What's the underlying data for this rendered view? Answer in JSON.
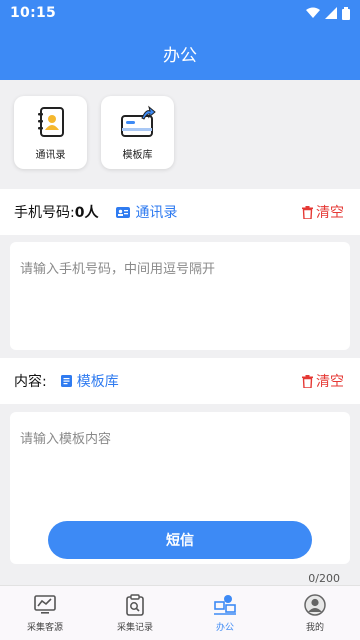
{
  "status_bar": {
    "time": "10:15"
  },
  "header": {
    "title": "办公"
  },
  "shortcuts": [
    {
      "label": "通讯录",
      "icon": "contacts-book-icon"
    },
    {
      "label": "模板库",
      "icon": "template-library-icon"
    }
  ],
  "phone_row": {
    "label": "手机号码:",
    "count": "0人",
    "contacts_link": "通讯录",
    "clear_label": "清空"
  },
  "phone_input": {
    "placeholder": "请输入手机号码，中间用逗号隔开",
    "value": ""
  },
  "content_row": {
    "label": "内容:",
    "template_link": "模板库",
    "clear_label": "清空"
  },
  "content_input": {
    "placeholder": "请输入模板内容",
    "value": ""
  },
  "send_button": {
    "label": "短信"
  },
  "char_counter": "0/200",
  "tabbar": {
    "tabs": [
      {
        "label": "采集客源",
        "icon": "chart-icon",
        "active": false
      },
      {
        "label": "采集记录",
        "icon": "clipboard-icon",
        "active": false
      },
      {
        "label": "办公",
        "icon": "office-icon",
        "active": true
      },
      {
        "label": "我的",
        "icon": "profile-icon",
        "active": false
      }
    ]
  },
  "colors": {
    "primary": "#3d8af5",
    "danger": "#e53935",
    "link": "#2f7bf0"
  }
}
